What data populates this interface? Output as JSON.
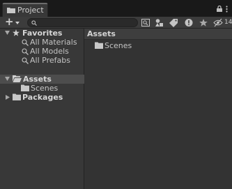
{
  "window": {
    "tab_label": "Project",
    "icons": {
      "tab": "folder-icon",
      "lock": "lock-icon",
      "menu": "kebab-menu-icon"
    }
  },
  "toolbar": {
    "add_label": "+",
    "search": {
      "value": "",
      "placeholder": ""
    },
    "hidden_count": "14",
    "icons": [
      "search-icon",
      "scene-view-icon",
      "filter-by-type-icon",
      "filter-by-label-icon",
      "warning-icon",
      "favorite-star-icon",
      "hidden-packages-icon"
    ]
  },
  "sidebar": {
    "favorites": {
      "label": "Favorites",
      "items": [
        {
          "label": "All Materials"
        },
        {
          "label": "All Models"
        },
        {
          "label": "All Prefabs"
        }
      ]
    },
    "assets": {
      "label": "Assets",
      "children": [
        {
          "label": "Scenes"
        }
      ]
    },
    "packages": {
      "label": "Packages"
    }
  },
  "main": {
    "breadcrumb": "Assets",
    "items": [
      {
        "label": "Scenes"
      }
    ]
  },
  "colors": {
    "panel_bg": "#383838",
    "content_bg": "#333333",
    "selection": "#4d4d4d",
    "text": "#c4c4c4"
  }
}
